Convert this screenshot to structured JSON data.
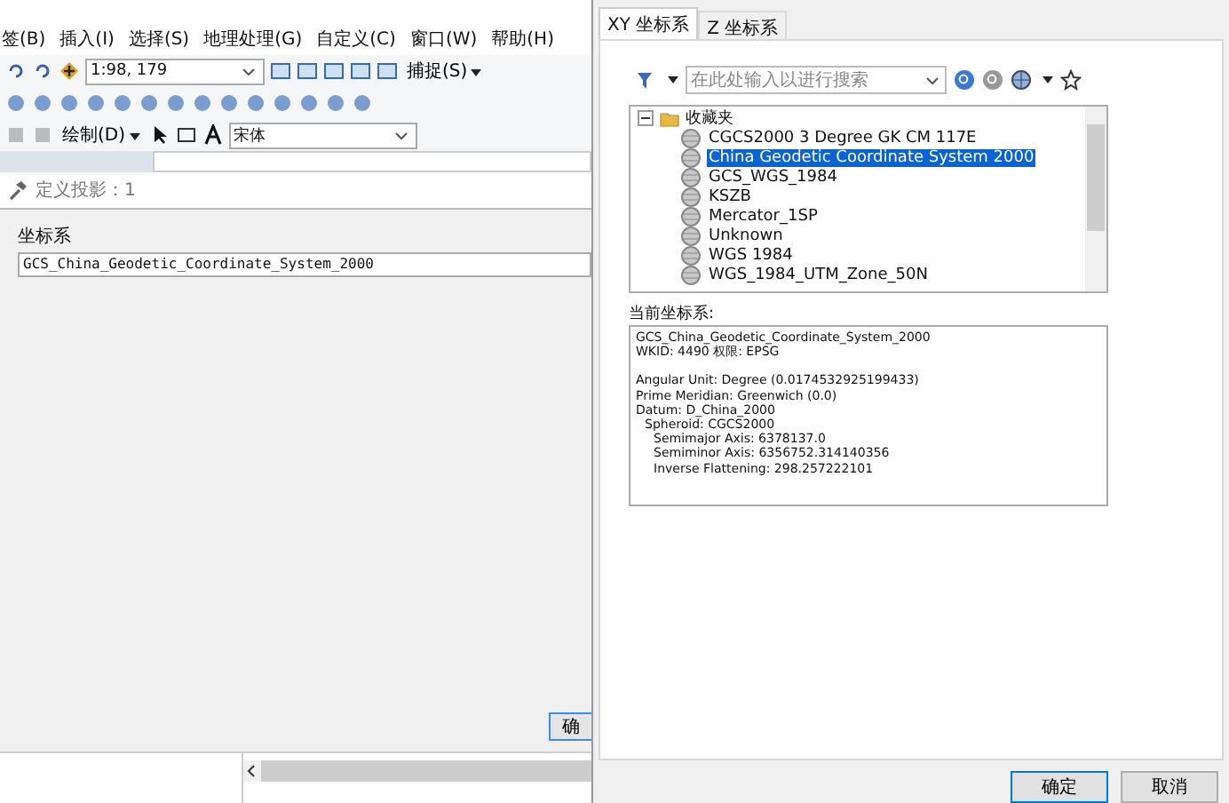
{
  "app": {
    "menu": [
      "签(B)",
      "插入(I)",
      "选择(S)",
      "地理处理(G)",
      "自定义(C)",
      "窗口(W)",
      "帮助(H)"
    ],
    "scale": "1:98, 179",
    "snap_menu": "捕捉(S)",
    "draw_menu": "绘制(D)",
    "font": "宋体"
  },
  "tool_dialog": {
    "title": "定义投影：1",
    "field_label": "坐标系",
    "field_value": "GCS_China_Geodetic_Coordinate_System_2000",
    "button": "确"
  },
  "dialog": {
    "tabs": [
      {
        "label": "XY 坐标系",
        "selected": true
      },
      {
        "label": "Z 坐标系",
        "selected": false
      }
    ],
    "search": {
      "placeholder": "在此处输入以进行搜索"
    },
    "tree": [
      {
        "label": "收藏夹",
        "expanded": true,
        "children": [
          {
            "label": "CGCS2000 3 Degree GK CM 117E",
            "selected": false
          },
          {
            "label": "China Geodetic Coordinate System 2000",
            "selected": true
          },
          {
            "label": "GCS_WGS_1984",
            "selected": false
          },
          {
            "label": "KSZB",
            "selected": false
          },
          {
            "label": "Mercator_1SP",
            "selected": false
          },
          {
            "label": "Unknown",
            "selected": false
          },
          {
            "label": "WGS 1984",
            "selected": false
          },
          {
            "label": "WGS_1984_UTM_Zone_50N",
            "selected": false
          }
        ]
      }
    ],
    "current_label": "当前坐标系:",
    "details": [
      [
        {
          "text": "GCS_China_Geodetic_Coordinate_System_2000"
        },
        {
          "text": "WKID: 4490 权限: EPSG"
        }
      ],
      [
        {
          "text": "Angular Unit: Degree (0.0174532925199433)"
        },
        {
          "text": "Prime Meridian: Greenwich (0.0)"
        },
        {
          "text": "Datum: D_China_2000",
          "children": [
            {
              "text": "Spheroid: CGCS2000",
              "children": [
                {
                  "text": "Semimajor Axis: 6378137.0"
                },
                {
                  "text": "Semiminor Axis: 6356752.314140356"
                },
                {
                  "text": "Inverse Flattening: 298.257222101"
                }
              ]
            }
          ]
        }
      ]
    ],
    "buttons": [
      "确定",
      "取消"
    ]
  }
}
